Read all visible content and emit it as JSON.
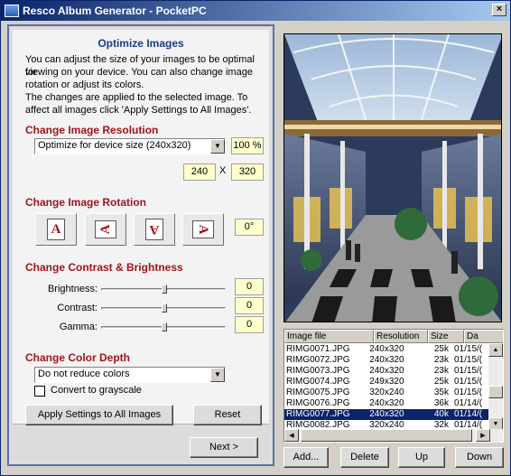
{
  "window": {
    "title": "Resco Album Generator - PocketPC",
    "close": "×"
  },
  "intro": {
    "heading": "Optimize Images",
    "lines": [
      "You can adjust the size of your images to be optimal for",
      "viewing on your device. You can also change image",
      "rotation or adjust its colors.",
      "The changes are applied to the selected image. To",
      "affect all images click 'Apply Settings to All Images'."
    ]
  },
  "resolution": {
    "title": "Change Image Resolution",
    "select_value": "Optimize for device size (240x320)",
    "percent": "100 %",
    "width": "240",
    "separator": "X",
    "height": "320"
  },
  "rotation": {
    "title": "Change Image Rotation",
    "buttons": [
      {
        "name": "rotate-none",
        "glyph": "A"
      },
      {
        "name": "rotate-left",
        "glyph": "A"
      },
      {
        "name": "rotate-flip",
        "glyph": "A"
      },
      {
        "name": "rotate-right",
        "glyph": "A"
      }
    ],
    "angle": "0°"
  },
  "contrast": {
    "title": "Change Contrast & Brightness",
    "sliders": [
      {
        "label": "Brightness:",
        "value": "0",
        "level": 0.5
      },
      {
        "label": "Contrast:",
        "value": "0",
        "level": 0.5
      },
      {
        "label": "Gamma:",
        "value": "0",
        "level": 0.5
      }
    ]
  },
  "color_depth": {
    "title": "Change Color Depth",
    "select_value": "Do not reduce colors",
    "grayscale_label": "Convert to grayscale",
    "grayscale_checked": false
  },
  "actions": {
    "apply_all": "Apply Settings to All Images",
    "reset": "Reset",
    "next": "Next >"
  },
  "file_list": {
    "columns": [
      "Image file",
      "Resolution",
      "Size",
      "Da"
    ],
    "rows": [
      [
        "RIMG0071.JPG",
        "240x320",
        "25k",
        "01/15/("
      ],
      [
        "RIMG0072.JPG",
        "240x320",
        "23k",
        "01/15/("
      ],
      [
        "RIMG0073.JPG",
        "240x320",
        "23k",
        "01/15/("
      ],
      [
        "RIMG0074.JPG",
        "249x320",
        "25k",
        "01/15/("
      ],
      [
        "RIMG0075.JPG",
        "320x240",
        "35k",
        "01/15/("
      ],
      [
        "RIMG0076.JPG",
        "240x320",
        "36k",
        "01/14/("
      ],
      [
        "RIMG0077.JPG",
        "240x320",
        "40k",
        "01/14/("
      ],
      [
        "RIMG0082.JPG",
        "320x240",
        "32k",
        "01/14/("
      ]
    ],
    "selected_index": 6
  },
  "list_buttons": {
    "add": "Add...",
    "delete": "Delete",
    "up": "Up",
    "down": "Down"
  },
  "colors": {
    "title_gradient_start": "#0a246a",
    "section_title": "#a0141e",
    "heading": "#1a3c8a",
    "value_box": "#ffffcc",
    "selection": "#0a246a"
  }
}
